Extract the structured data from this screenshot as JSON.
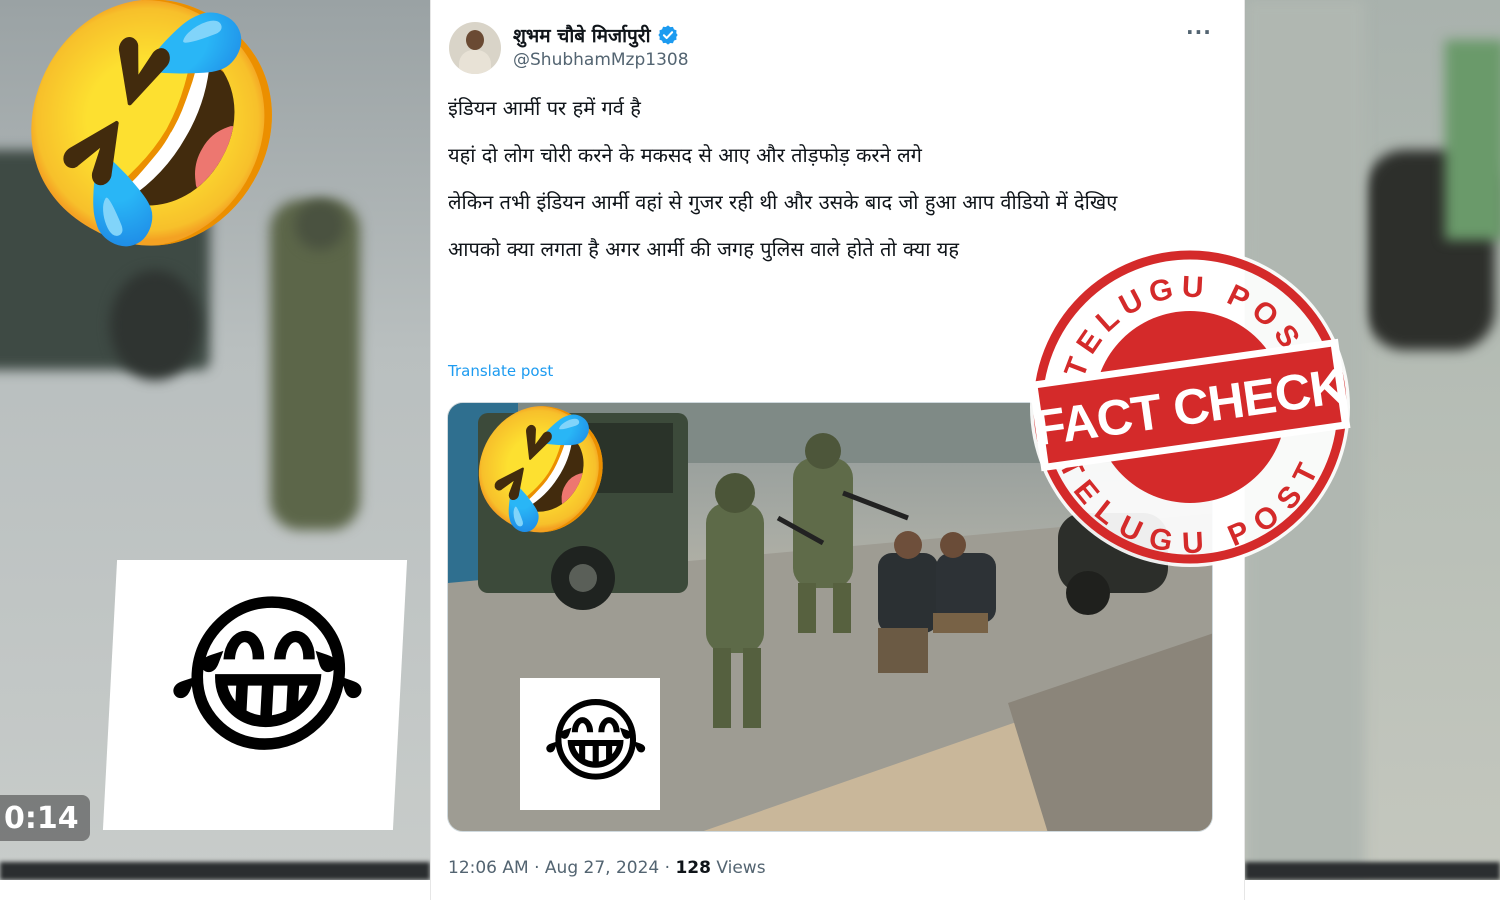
{
  "background": {
    "video_timestamp": "0:14",
    "emojis": [
      "🤣",
      "😂"
    ]
  },
  "tweet": {
    "display_name": "शुभम चौबे मिर्जापुरी",
    "handle": "@ShubhamMzp1308",
    "more_label": "···",
    "verified_icon": "verified-badge-icon",
    "paragraphs": [
      "इंडियन आर्मी पर हमें गर्व है",
      "यहां दो लोग चोरी करने के मकसद से आए और तोड़फोड़ करने लगे",
      "लेकिन तभी इंडियन आर्मी वहां से गुजर रही थी और उसके बाद जो हुआ आप वीडियो में देखिए",
      "आपको क्या लगता है अगर आर्मी की जगह पुलिस वाले होते तो क्या यह"
    ],
    "translate_label": "Translate post",
    "media_emojis": [
      "🤣",
      "😂"
    ],
    "time": "12:06 AM",
    "separator": "·",
    "date": "Aug 27, 2024",
    "views_count": "128",
    "views_label": "Views"
  },
  "stamp": {
    "top_text": "TELUGU POST",
    "center_text": "FACT CHECK",
    "bottom_text": "TELUGU POST"
  },
  "colors": {
    "stamp_red": "#d42a2a",
    "link_blue": "#1d9bf0",
    "verified_blue": "#1d9bf0",
    "text_primary": "#0f1419",
    "text_secondary": "#536471"
  }
}
